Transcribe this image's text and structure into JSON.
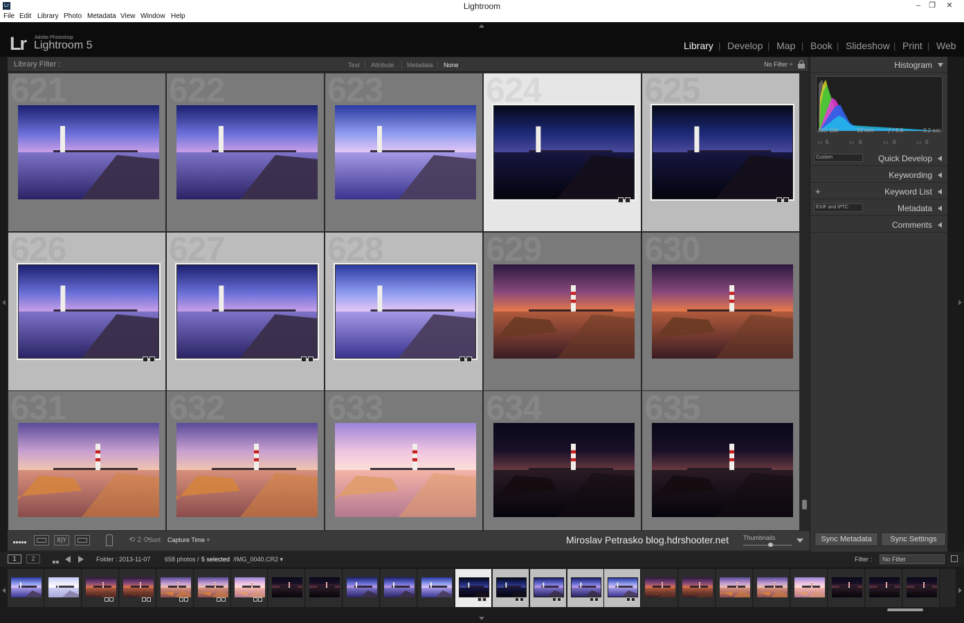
{
  "window": {
    "title": "Lightroom",
    "controls": {
      "minimize": "–",
      "maximize": "❐",
      "close": "✕"
    }
  },
  "menu": [
    "File",
    "Edit",
    "Library",
    "Photo",
    "Metadata",
    "View",
    "Window",
    "Help"
  ],
  "branding": {
    "logo": "Lr",
    "adobe": "Adobe Photoshop",
    "product": "Lightroom 5"
  },
  "modules": [
    {
      "label": "Library",
      "active": true
    },
    {
      "label": "Develop",
      "active": false
    },
    {
      "label": "Map",
      "active": false
    },
    {
      "label": "Book",
      "active": false
    },
    {
      "label": "Slideshow",
      "active": false
    },
    {
      "label": "Print",
      "active": false
    },
    {
      "label": "Web",
      "active": false
    }
  ],
  "module_separator": "|",
  "filter_bar": {
    "title": "Library Filter :",
    "options": [
      "Text",
      "Attribute",
      "Metadata",
      "None"
    ],
    "selected": "None",
    "preset": "No Filter ÷",
    "lock_icon": "lock-icon"
  },
  "grid": {
    "cells": [
      {
        "num": "621",
        "state": "unselected",
        "scene": "blue"
      },
      {
        "num": "622",
        "state": "unselected",
        "scene": "blue"
      },
      {
        "num": "623",
        "state": "unselected",
        "scene": "blue-light"
      },
      {
        "num": "624",
        "state": "primary",
        "scene": "dark-blue"
      },
      {
        "num": "625",
        "state": "selected",
        "scene": "dark-blue"
      },
      {
        "num": "626",
        "state": "selected",
        "scene": "blue"
      },
      {
        "num": "627",
        "state": "selected",
        "scene": "blue"
      },
      {
        "num": "628",
        "state": "selected",
        "scene": "blue-light"
      },
      {
        "num": "629",
        "state": "unselected",
        "scene": "sunset-dark"
      },
      {
        "num": "630",
        "state": "unselected",
        "scene": "sunset-dark"
      },
      {
        "num": "631",
        "state": "unselected",
        "scene": "sunset"
      },
      {
        "num": "632",
        "state": "unselected",
        "scene": "sunset"
      },
      {
        "num": "633",
        "state": "unselected",
        "scene": "sunset-bright"
      },
      {
        "num": "634",
        "state": "unselected",
        "scene": "night"
      },
      {
        "num": "635",
        "state": "unselected",
        "scene": "night"
      }
    ],
    "badge_icons": [
      "crop-badge-icon",
      "develop-badge-icon"
    ]
  },
  "toolbar": {
    "sort_label": "Sort:",
    "sort_value": "Capture Time ÷",
    "rotate_icon": "⟲ 2 ⟳",
    "xy_label": "X|Y",
    "watermark": "Miroslav  Petrasko  blog.hdrshooter.net",
    "thumbnails_label": "Thumbnails"
  },
  "right_panel": {
    "histogram": {
      "title": "Histogram",
      "iso": "ISO 100",
      "focal": "16 mm",
      "aperture": "ƒ / 5.6",
      "shutter": "3.2 sec",
      "tools": [
        "5",
        "0",
        "0",
        "0"
      ]
    },
    "sections": [
      {
        "title": "Quick Develop",
        "select": "Custom"
      },
      {
        "title": "Keywording"
      },
      {
        "title": "Keyword List",
        "plus": "+"
      },
      {
        "title": "Metadata",
        "select": "EXIF and IPTC"
      },
      {
        "title": "Comments"
      }
    ],
    "sync_metadata": "Sync Metadata",
    "sync_settings": "Sync Settings"
  },
  "filmstrip_info": {
    "page1": "1",
    "page2": "2",
    "folder": "Folder : 2013-11-07",
    "count": "658 photos /",
    "selected": "5 selected",
    "file": "/IMG_0040.CR2 ▾",
    "filter_label": "Filter :",
    "filter_value": "No Filter"
  },
  "filmstrip": [
    {
      "scene": "blue-light",
      "state": "unselected",
      "badge": false
    },
    {
      "scene": "bright",
      "state": "unselected",
      "badge": false
    },
    {
      "scene": "sunset-dark",
      "state": "unselected",
      "badge": true
    },
    {
      "scene": "sunset-dark",
      "state": "unselected",
      "badge": true
    },
    {
      "scene": "sunset",
      "state": "unselected",
      "badge": true
    },
    {
      "scene": "sunset",
      "state": "unselected",
      "badge": true
    },
    {
      "scene": "sunset-bright",
      "state": "unselected",
      "badge": true
    },
    {
      "scene": "night",
      "state": "unselected",
      "badge": false
    },
    {
      "scene": "night",
      "state": "unselected",
      "badge": false
    },
    {
      "scene": "blue",
      "state": "unselected",
      "badge": false
    },
    {
      "scene": "blue",
      "state": "unselected",
      "badge": false
    },
    {
      "scene": "blue-light",
      "state": "unselected",
      "badge": false
    },
    {
      "scene": "dark-blue",
      "state": "primary",
      "badge": true
    },
    {
      "scene": "dark-blue",
      "state": "selected",
      "badge": true
    },
    {
      "scene": "blue",
      "state": "selected",
      "badge": true
    },
    {
      "scene": "blue",
      "state": "selected",
      "badge": true
    },
    {
      "scene": "blue-light",
      "state": "selected",
      "badge": true
    },
    {
      "scene": "sunset-dark",
      "state": "unselected",
      "badge": false
    },
    {
      "scene": "sunset-dark",
      "state": "unselected",
      "badge": false
    },
    {
      "scene": "sunset",
      "state": "unselected",
      "badge": false
    },
    {
      "scene": "sunset",
      "state": "unselected",
      "badge": false
    },
    {
      "scene": "sunset-bright",
      "state": "unselected",
      "badge": false
    },
    {
      "scene": "night",
      "state": "unselected",
      "badge": false
    },
    {
      "scene": "night",
      "state": "unselected",
      "badge": false
    },
    {
      "scene": "night",
      "state": "unselected",
      "badge": false
    }
  ],
  "colors": {
    "panel": "#353535",
    "grid_unselected": "#7a7a7a",
    "grid_selected": "#bcbcbc",
    "grid_primary": "#e6e6e6",
    "module_active": "#f2f2f2"
  }
}
